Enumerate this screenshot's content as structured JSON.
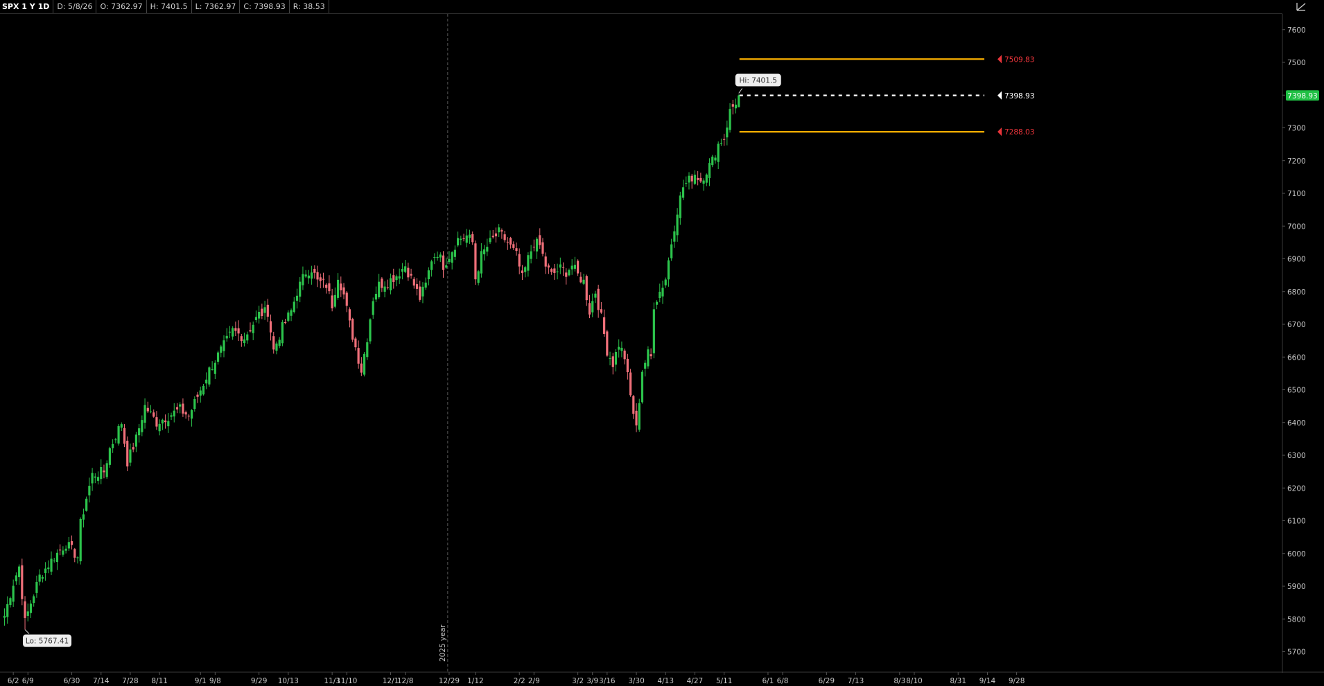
{
  "header": {
    "symbol": "SPX 1 Y 1D",
    "date": "D: 5/8/26",
    "open": "O: 7362.97",
    "high": "H: 7401.5",
    "low": "L: 7362.97",
    "close": "C: 7398.93",
    "range": "R: 38.53"
  },
  "chart_data": {
    "type": "candlestick",
    "y_ticks": [
      5700,
      5800,
      5900,
      6000,
      6100,
      6200,
      6300,
      6400,
      6500,
      6600,
      6700,
      6800,
      6900,
      7000,
      7100,
      7200,
      7300,
      7400,
      7500,
      7600
    ],
    "ylim": [
      5675,
      7640
    ],
    "x_tick_labels": [
      {
        "label": "6/2",
        "bar": 3
      },
      {
        "label": "6/9",
        "bar": 8
      },
      {
        "label": "6/30",
        "bar": 23
      },
      {
        "label": "7/14",
        "bar": 33
      },
      {
        "label": "7/28",
        "bar": 43
      },
      {
        "label": "8/11",
        "bar": 53
      },
      {
        "label": "9/1",
        "bar": 67
      },
      {
        "label": "9/8",
        "bar": 72
      },
      {
        "label": "9/29",
        "bar": 87
      },
      {
        "label": "10/13",
        "bar": 97
      },
      {
        "label": "11/3",
        "bar": 112
      },
      {
        "label": "11/10",
        "bar": 117
      },
      {
        "label": "12/1",
        "bar": 132
      },
      {
        "label": "12/8",
        "bar": 137
      },
      {
        "label": "12/29",
        "bar": 152
      },
      {
        "label": "1/12",
        "bar": 161
      },
      {
        "label": "2/2",
        "bar": 176
      },
      {
        "label": "2/9",
        "bar": 181
      },
      {
        "label": "3/2",
        "bar": 196
      },
      {
        "label": "3/9",
        "bar": 201
      },
      {
        "label": "3/16",
        "bar": 206
      },
      {
        "label": "3/30",
        "bar": 216
      },
      {
        "label": "4/13",
        "bar": 226
      },
      {
        "label": "4/27",
        "bar": 236
      },
      {
        "label": "5/11",
        "bar": 246
      },
      {
        "label": "6/1",
        "bar": 261
      },
      {
        "label": "6/8",
        "bar": 266
      },
      {
        "label": "6/29",
        "bar": 281
      },
      {
        "label": "7/13",
        "bar": 291
      },
      {
        "label": "8/3",
        "bar": 306
      },
      {
        "label": "8/10",
        "bar": 311
      },
      {
        "label": "8/31",
        "bar": 326
      },
      {
        "label": "9/14",
        "bar": 336
      },
      {
        "label": "9/28",
        "bar": 346
      }
    ],
    "year_divider": {
      "label": "2025 year",
      "bar": 151.5
    },
    "waypoints": [
      [
        0,
        5810
      ],
      [
        3,
        5910
      ],
      [
        5,
        5960
      ],
      [
        7,
        5790
      ],
      [
        9,
        5850
      ],
      [
        12,
        5930
      ],
      [
        17,
        5990
      ],
      [
        21,
        6030
      ],
      [
        25,
        5990
      ],
      [
        26,
        6090
      ],
      [
        28,
        6170
      ],
      [
        30,
        6240
      ],
      [
        34,
        6250
      ],
      [
        36,
        6320
      ],
      [
        40,
        6400
      ],
      [
        42,
        6280
      ],
      [
        45,
        6350
      ],
      [
        48,
        6450
      ],
      [
        52,
        6400
      ],
      [
        56,
        6420
      ],
      [
        60,
        6440
      ],
      [
        63,
        6420
      ],
      [
        67,
        6500
      ],
      [
        70,
        6560
      ],
      [
        74,
        6620
      ],
      [
        78,
        6680
      ],
      [
        82,
        6660
      ],
      [
        87,
        6730
      ],
      [
        90,
        6740
      ],
      [
        92,
        6620
      ],
      [
        95,
        6690
      ],
      [
        98,
        6740
      ],
      [
        100,
        6800
      ],
      [
        103,
        6860
      ],
      [
        105,
        6870
      ],
      [
        107,
        6830
      ],
      [
        110,
        6820
      ],
      [
        112,
        6760
      ],
      [
        114,
        6850
      ],
      [
        116,
        6790
      ],
      [
        118,
        6700
      ],
      [
        120,
        6630
      ],
      [
        122,
        6560
      ],
      [
        124,
        6660
      ],
      [
        126,
        6780
      ],
      [
        128,
        6820
      ],
      [
        131,
        6830
      ],
      [
        134,
        6850
      ],
      [
        137,
        6880
      ],
      [
        140,
        6820
      ],
      [
        142,
        6780
      ],
      [
        144,
        6820
      ],
      [
        146,
        6900
      ],
      [
        148,
        6920
      ],
      [
        150,
        6880
      ],
      [
        152,
        6910
      ],
      [
        155,
        6960
      ],
      [
        158,
        6970
      ],
      [
        160,
        6950
      ],
      [
        161,
        6840
      ],
      [
        163,
        6910
      ],
      [
        166,
        6950
      ],
      [
        169,
        6980
      ],
      [
        172,
        6950
      ],
      [
        175,
        6910
      ],
      [
        177,
        6840
      ],
      [
        179,
        6900
      ],
      [
        181,
        6950
      ],
      [
        183,
        6940
      ],
      [
        185,
        6880
      ],
      [
        187,
        6850
      ],
      [
        190,
        6870
      ],
      [
        192,
        6860
      ],
      [
        194,
        6880
      ],
      [
        196,
        6850
      ],
      [
        198,
        6830
      ],
      [
        200,
        6740
      ],
      [
        202,
        6800
      ],
      [
        204,
        6720
      ],
      [
        206,
        6620
      ],
      [
        208,
        6580
      ],
      [
        210,
        6640
      ],
      [
        212,
        6600
      ],
      [
        214,
        6480
      ],
      [
        216,
        6380
      ],
      [
        218,
        6560
      ],
      [
        220,
        6610
      ],
      [
        221,
        6600
      ],
      [
        222,
        6760
      ],
      [
        224,
        6800
      ],
      [
        226,
        6840
      ],
      [
        228,
        6950
      ],
      [
        230,
        7050
      ],
      [
        232,
        7120
      ],
      [
        234,
        7140
      ],
      [
        236,
        7160
      ],
      [
        238,
        7140
      ],
      [
        240,
        7170
      ],
      [
        242,
        7200
      ],
      [
        244,
        7250
      ],
      [
        246,
        7270
      ],
      [
        248,
        7350
      ],
      [
        250,
        7380
      ],
      [
        251,
        7398.93
      ]
    ],
    "last_bar": {
      "open": 7362.97,
      "high": 7401.5,
      "low": 7362.97,
      "close": 7398.93
    },
    "annotations": {
      "hi_label": "Hi: 7401.5",
      "lo_label": "Lo: 5767.41",
      "hi_value": 7401.5,
      "lo_value": 5767.41,
      "lo_bar": 7
    },
    "levels": [
      {
        "value": 7509.83,
        "label": "7509.83",
        "color": "#f2a900",
        "label_color": "#e8343a",
        "style": "solid"
      },
      {
        "value": 7398.93,
        "label": "7398.93",
        "color": "#ffffff",
        "label_color": "#ffffff",
        "style": "dotted"
      },
      {
        "value": 7288.03,
        "label": "7288.03",
        "color": "#f2a900",
        "label_color": "#e8343a",
        "style": "solid"
      }
    ],
    "current_price": {
      "label": "7398.93",
      "color": "#1fbf44"
    },
    "up_color": "#2cc44c",
    "down_color": "#f0707a"
  }
}
